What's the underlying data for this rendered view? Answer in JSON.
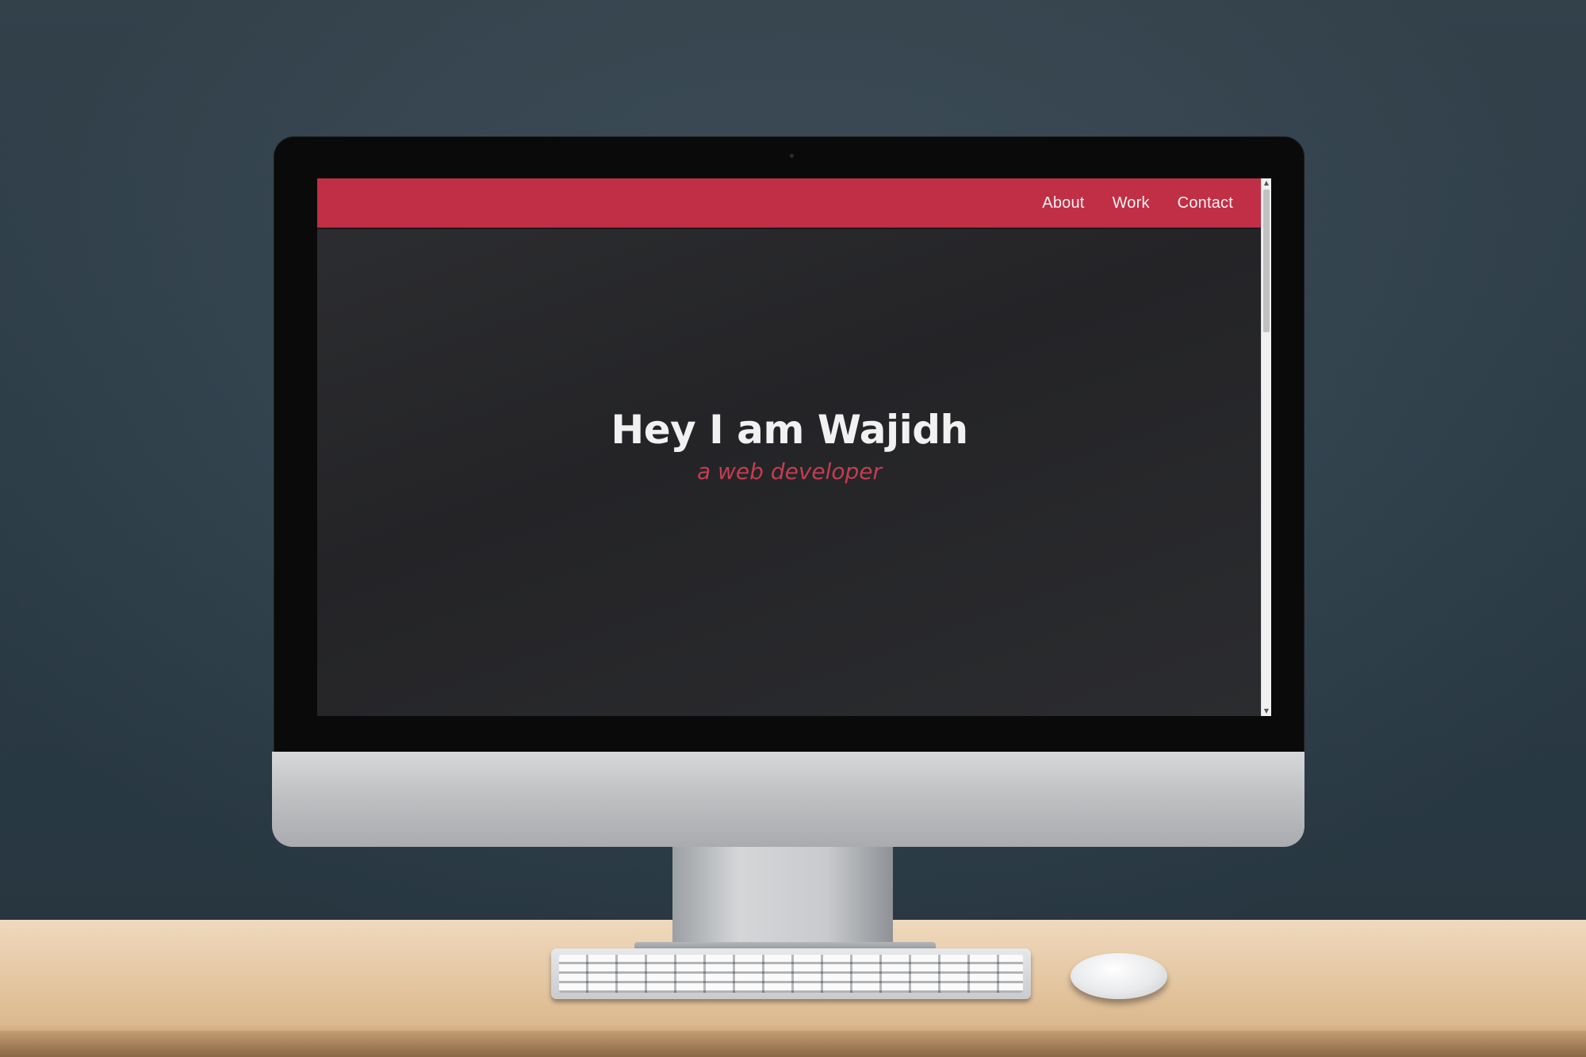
{
  "nav": {
    "items": [
      {
        "label": "About"
      },
      {
        "label": "Work"
      },
      {
        "label": "Contact"
      }
    ]
  },
  "hero": {
    "title": "Hey I am Wajidh",
    "subtitle": "a web developer"
  },
  "colors": {
    "accent": "#c02f45",
    "background": "#252528",
    "heading": "#f1f1f1"
  },
  "icons": {
    "scroll_up": "arrow-up-icon",
    "scroll_down": "arrow-down-icon"
  }
}
